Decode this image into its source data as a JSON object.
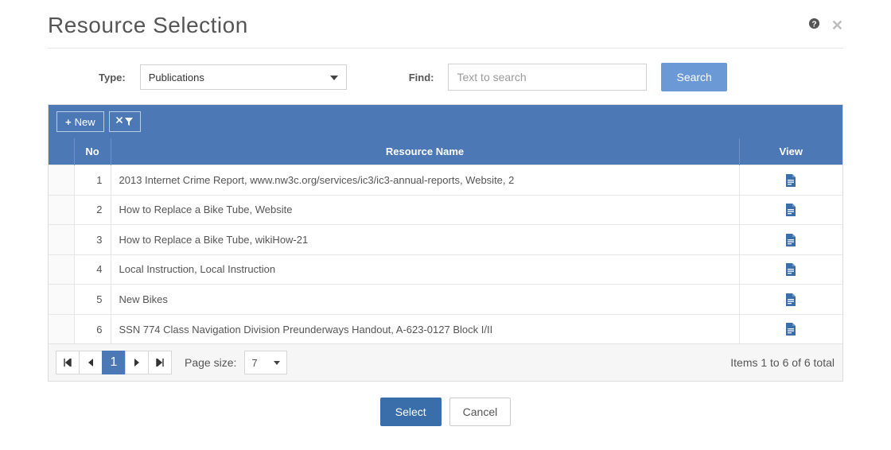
{
  "header": {
    "title": "Resource Selection",
    "help_icon": "help-icon",
    "close_icon": "close-icon"
  },
  "filters": {
    "type_label": "Type:",
    "type_value": "Publications",
    "find_label": "Find:",
    "find_placeholder": "Text to search",
    "search_label": "Search"
  },
  "toolbar": {
    "new_label": "New"
  },
  "columns": {
    "col_blank": "",
    "col_no": "No",
    "col_name": "Resource Name",
    "col_view": "View"
  },
  "rows": [
    {
      "no": "1",
      "name": "2013 Internet Crime Report, www.nw3c.org/services/ic3/ic3-annual-reports, Website, 2"
    },
    {
      "no": "2",
      "name": "How to Replace a Bike Tube, Website"
    },
    {
      "no": "3",
      "name": "How to Replace a Bike Tube, wikiHow-21"
    },
    {
      "no": "4",
      "name": "Local Instruction, Local Instruction"
    },
    {
      "no": "5",
      "name": "New Bikes"
    },
    {
      "no": "6",
      "name": "SSN 774 Class Navigation Division Preunderways Handout, A-623-0127 Block I/II"
    }
  ],
  "pager": {
    "current": "1",
    "size_label": "Page size:",
    "size_value": "7",
    "summary": "Items 1 to 6 of 6 total"
  },
  "footer": {
    "select_label": "Select",
    "cancel_label": "Cancel"
  }
}
